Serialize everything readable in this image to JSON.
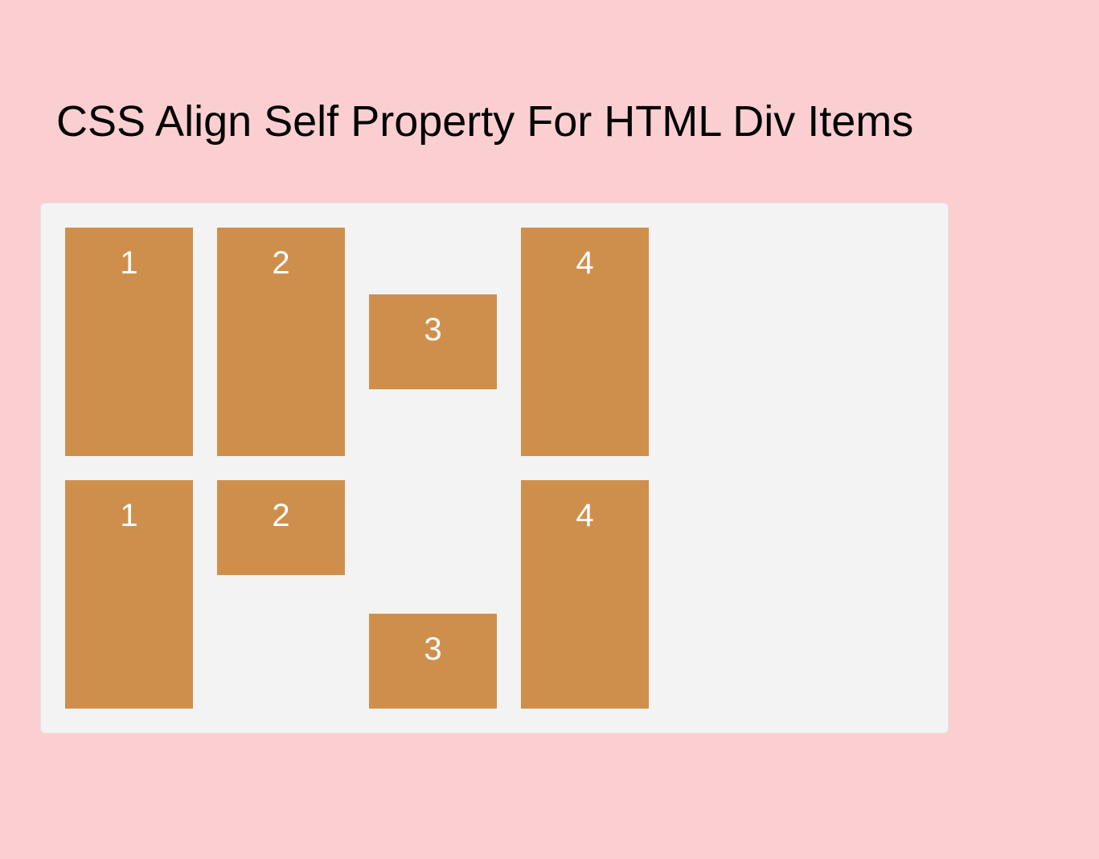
{
  "title": "CSS Align Self Property For HTML Div Items",
  "rows": [
    {
      "boxes": [
        "1",
        "2",
        "3",
        "4"
      ]
    },
    {
      "boxes": [
        "1",
        "2",
        "3",
        "4"
      ]
    }
  ]
}
